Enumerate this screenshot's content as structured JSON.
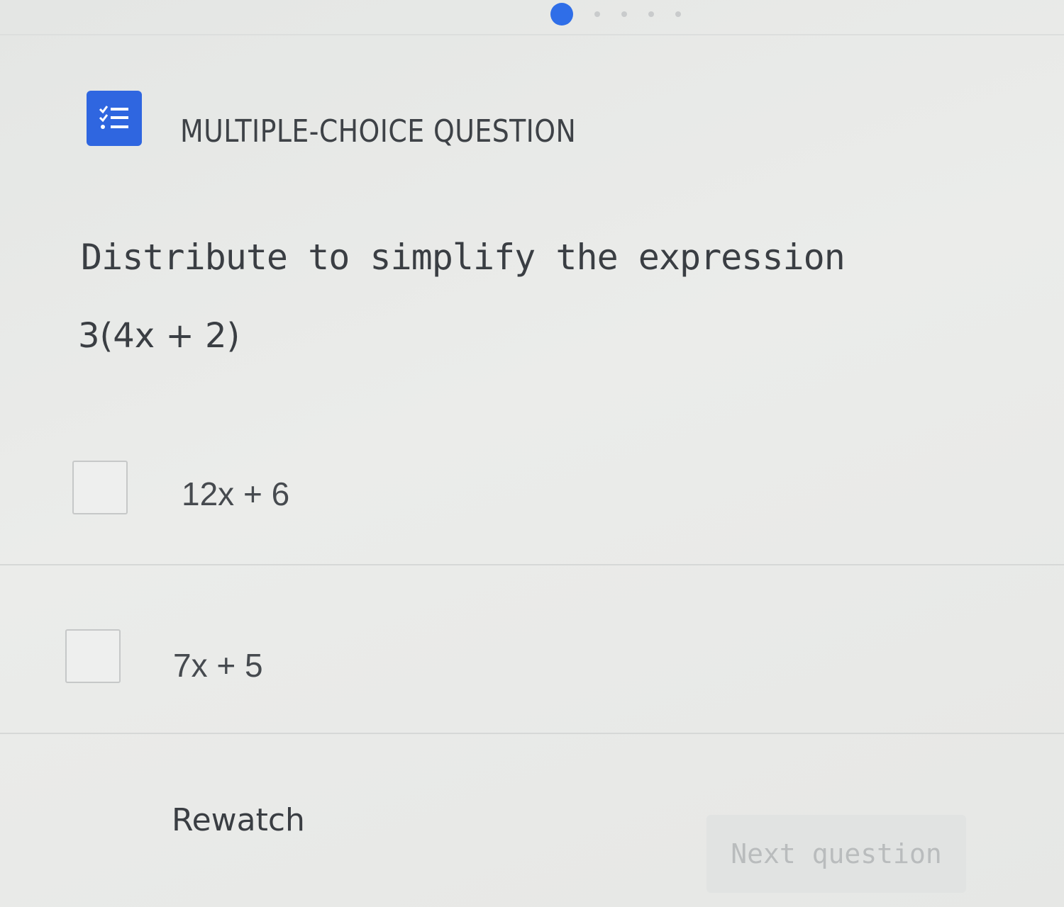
{
  "progress": {
    "current_step": 1,
    "total_steps": 5
  },
  "header": {
    "type_label": "MULTIPLE-CHOICE QUESTION",
    "type_icon": "checklist-icon",
    "accent_color": "#2f66e0"
  },
  "question": {
    "prompt": "Distribute to simplify the expression",
    "expression": "3(4x + 2)"
  },
  "options": [
    {
      "label": "12x + 6",
      "checked": false
    },
    {
      "label": "7x + 5",
      "checked": false
    }
  ],
  "footer": {
    "rewatch_label": "Rewatch",
    "next_label": "Next question",
    "next_enabled": false
  }
}
